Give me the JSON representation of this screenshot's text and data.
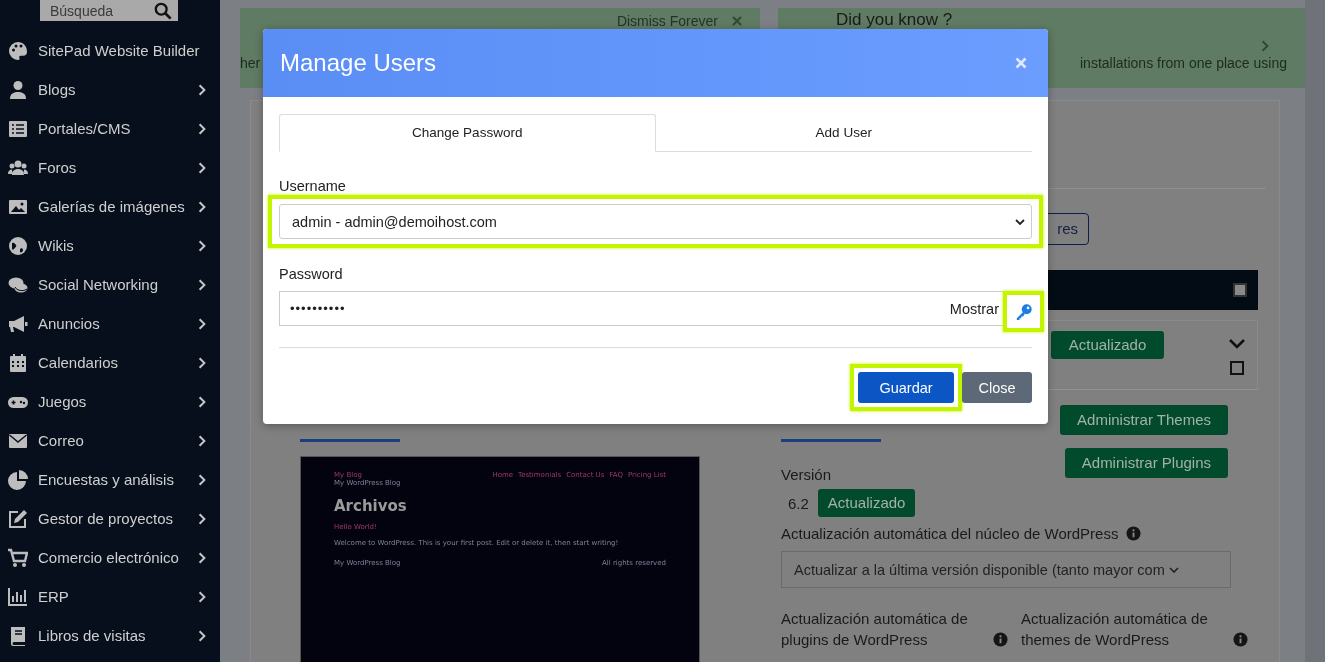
{
  "sidebar": {
    "search_placeholder": "Búsqueda",
    "items": [
      {
        "label": "SitePad Website Builder",
        "has_submenu": false
      },
      {
        "label": "Blogs",
        "has_submenu": true
      },
      {
        "label": "Portales/CMS",
        "has_submenu": true
      },
      {
        "label": "Foros",
        "has_submenu": true
      },
      {
        "label": "Galerías de imágenes",
        "has_submenu": true
      },
      {
        "label": "Wikis",
        "has_submenu": true
      },
      {
        "label": "Social Networking",
        "has_submenu": true
      },
      {
        "label": "Anuncios",
        "has_submenu": true
      },
      {
        "label": "Calendarios",
        "has_submenu": true
      },
      {
        "label": "Juegos",
        "has_submenu": true
      },
      {
        "label": "Correo",
        "has_submenu": true
      },
      {
        "label": "Encuestas y análisis",
        "has_submenu": true
      },
      {
        "label": "Gestor de proyectos",
        "has_submenu": true
      },
      {
        "label": "Comercio electrónico",
        "has_submenu": true
      },
      {
        "label": "ERP",
        "has_submenu": true
      },
      {
        "label": "Libros de visitas",
        "has_submenu": true
      }
    ]
  },
  "notices": [
    {
      "kind": "dismissable",
      "dismiss_label": "Dismiss Forever",
      "text": "her"
    },
    {
      "kind": "tip",
      "title": "Did you know ?",
      "text": "installations from one place using"
    }
  ],
  "installation": {
    "search_button": "res",
    "header_checked": false,
    "status_button": "Actualizado",
    "row_checked": false,
    "manage_themes": "Administrar Themes",
    "manage_plugins": "Administrar Plugins",
    "version_label": "Versión",
    "version": "6.2",
    "version_status": "Actualizado",
    "core_update_label": "Actualización automática del núcleo de WordPress",
    "core_update_value": "Actualizar a la última versión disponible (tanto mayor com",
    "plugins_update_label": "Actualización automática de plugins de WordPress",
    "themes_update_label": "Actualización automática de themes de WordPress",
    "preview": {
      "site_title": "My Blog",
      "tagline": "My WordPress Blog",
      "nav": [
        "Home",
        "Testimonials",
        "Contact Us",
        "FAQ",
        "Pricing List"
      ],
      "heading": "Archivos",
      "post_title": "Hello World!",
      "post_excerpt": "Welcome to WordPress. This is your first post. Edit or delete it, then start writing!",
      "footer_left": "My WordPress Blog",
      "footer_right": "All rights reserved"
    }
  },
  "modal": {
    "title": "Manage Users",
    "tabs": [
      {
        "label": "Change Password",
        "selected": true
      },
      {
        "label": "Add User",
        "selected": false
      }
    ],
    "username": {
      "label": "Username",
      "value": "admin - admin@demoihost.com",
      "highlighted": true
    },
    "password": {
      "label": "Password",
      "value": "••••••••••",
      "toggle_label": "Mostrar",
      "generate_highlighted": true
    },
    "buttons": [
      {
        "label": "Guardar",
        "kind": "primary",
        "highlighted": true
      },
      {
        "label": "Close",
        "kind": "secondary",
        "highlighted": false
      }
    ]
  }
}
